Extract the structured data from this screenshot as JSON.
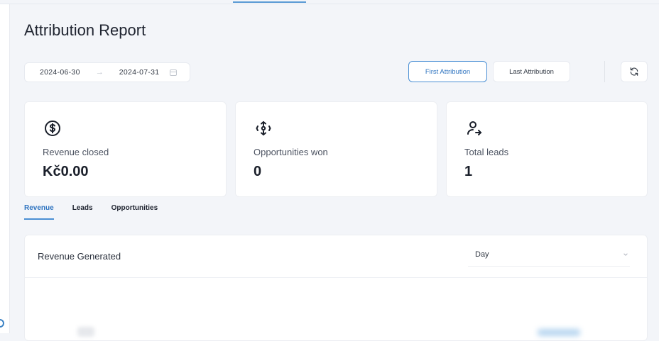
{
  "page": {
    "title": "Attribution Report"
  },
  "filters": {
    "date_start": "2024-06-30",
    "date_arrow": "→",
    "date_end": "2024-07-31",
    "attribution": {
      "first_label": "First Attribution",
      "last_label": "Last Attribution",
      "selected": "First Attribution"
    }
  },
  "stats": [
    {
      "icon": "dollar-circle-icon",
      "label": "Revenue closed",
      "value": "Kč0.00"
    },
    {
      "icon": "opportunities-icon",
      "label": "Opportunities won",
      "value": "0"
    },
    {
      "icon": "user-arrow-icon",
      "label": "Total leads",
      "value": "1"
    }
  ],
  "tabs": [
    {
      "label": "Revenue",
      "active": true
    },
    {
      "label": "Leads",
      "active": false
    },
    {
      "label": "Opportunities",
      "active": false
    }
  ],
  "panel": {
    "title": "Revenue Generated",
    "granularity_value": "Day"
  },
  "colors": {
    "accent": "#4a8fd4",
    "accent_text": "#2f74c0",
    "background": "#f3f5f9",
    "card": "#ffffff"
  }
}
